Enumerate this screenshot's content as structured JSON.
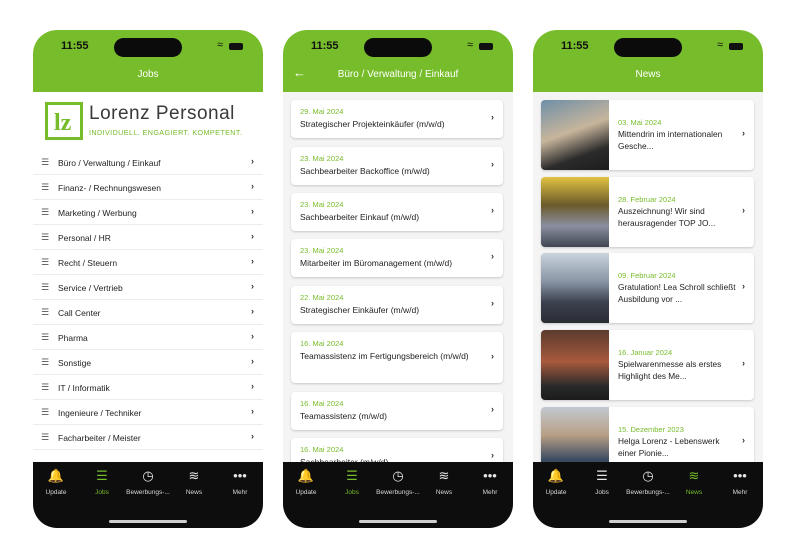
{
  "colors": {
    "brand": "#77bc2b",
    "tabbar": "#0d0d0d"
  },
  "status": {
    "time": "11:55"
  },
  "tabs": [
    {
      "label": "Update",
      "icon": "bell-icon",
      "glyph": "🔔"
    },
    {
      "label": "Jobs",
      "icon": "list-icon",
      "glyph": "☰"
    },
    {
      "label": "Bewerbungs-...",
      "icon": "clock-icon",
      "glyph": "◷"
    },
    {
      "label": "News",
      "icon": "rss-icon",
      "glyph": "≋"
    },
    {
      "label": "Mehr",
      "icon": "more-icon",
      "glyph": "•••"
    }
  ],
  "screen1": {
    "title": "Jobs",
    "logo": {
      "name": "Lorenz Personal",
      "tagline": "INDIVIDUELL. ENGAGIERT. KOMPETENT."
    },
    "categories": [
      "Büro / Verwaltung / Einkauf",
      "Finanz- / Rechnungswesen",
      "Marketing / Werbung",
      "Personal / HR",
      "Recht / Steuern",
      "Service / Vertrieb",
      "Call Center",
      "Pharma",
      "Sonstige",
      "IT / Informatik",
      "Ingenieure / Techniker",
      "Facharbeiter / Meister"
    ]
  },
  "screen2": {
    "title": "Büro / Verwaltung / Einkauf",
    "jobs": [
      {
        "date": "29. Mai 2024",
        "title": "Strategischer Projekteinkäufer (m/w/d)"
      },
      {
        "date": "23. Mai 2024",
        "title": "Sachbearbeiter Backoffice (m/w/d)"
      },
      {
        "date": "23. Mai 2024",
        "title": "Sachbearbeiter Einkauf (m/w/d)"
      },
      {
        "date": "23. Mai 2024",
        "title": "Mitarbeiter im Büromanagement (m/w/d)"
      },
      {
        "date": "22. Mai 2024",
        "title": "Strategischer Einkäufer (m/w/d)"
      },
      {
        "date": "16. Mai 2024",
        "title": "Teamassistenz im Fertigungsbereich (m/w/d)"
      },
      {
        "date": "16. Mai 2024",
        "title": "Teamassistenz (m/w/d)"
      },
      {
        "date": "16. Mai 2024",
        "title": "Sachbearbeiter (m/w/d)"
      }
    ]
  },
  "screen3": {
    "title": "News",
    "news": [
      {
        "date": "03. Mai 2024",
        "title": "Mittendrin im internationalen Gesche..."
      },
      {
        "date": "28. Februar 2024",
        "title": "Auszeichnung! Wir sind herausragender TOP JO..."
      },
      {
        "date": "09. Februar 2024",
        "title": "Gratulation! Lea Schroll schließt Ausbildung vor ..."
      },
      {
        "date": "16. Januar 2024",
        "title": "Spielwarenmesse als erstes Highlight des Me..."
      },
      {
        "date": "15. Dezember 2023",
        "title": "Helga Lorenz - Lebenswerk einer Pionie..."
      }
    ]
  }
}
